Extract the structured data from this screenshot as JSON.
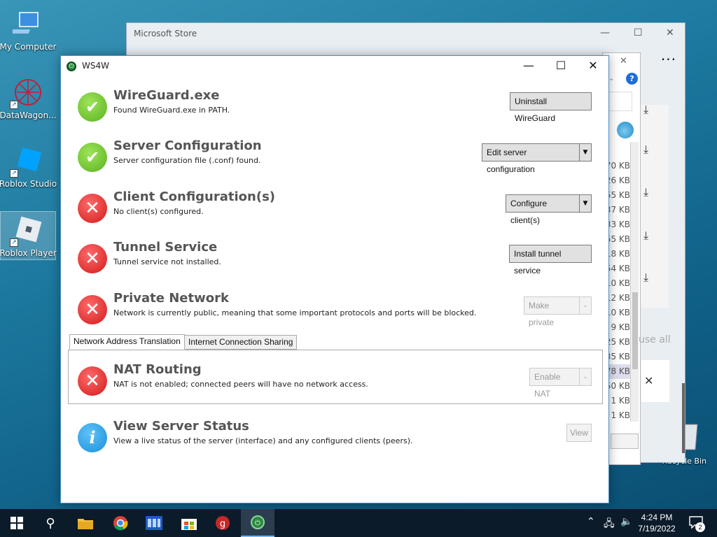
{
  "desktop": {
    "icons": [
      {
        "label": "My Computer"
      },
      {
        "label": "DataWagon..."
      },
      {
        "label": "Roblox Studio"
      },
      {
        "label": "Roblox Player"
      }
    ],
    "recycle_label": "Recycle Bin"
  },
  "store_window": {
    "title": "Microsoft Store",
    "sizes": [
      "70 KB",
      "26 KB",
      "55 KB",
      "37 KB",
      "33 KB",
      "55 KB",
      "18 KB",
      "54 KB",
      "10 KB",
      "12 KB",
      "10 KB",
      "9 KB",
      "25 KB",
      "35 KB",
      "78 KB",
      "50 KB",
      "1 KB",
      "1 KB"
    ],
    "pause_all_partial": "use all"
  },
  "app": {
    "title": "WS4W",
    "rows": {
      "wireguard": {
        "title": "WireGuard.exe",
        "desc": "Found WireGuard.exe in PATH.",
        "button": "Uninstall WireGuard",
        "status": "ok"
      },
      "server_config": {
        "title": "Server Configuration",
        "desc": "Server configuration file (.conf) found.",
        "button": "Edit server configuration",
        "status": "ok"
      },
      "client_config": {
        "title": "Client Configuration(s)",
        "desc": "No client(s) configured.",
        "button": "Configure client(s)",
        "status": "error"
      },
      "tunnel": {
        "title": "Tunnel Service",
        "desc": "Tunnel service not installed.",
        "button": "Install tunnel service",
        "status": "error"
      },
      "private_net": {
        "title": "Private Network",
        "desc": "Network is currently public, meaning that some important protocols and ports will be blocked.",
        "button": "Make private",
        "status": "error"
      },
      "nat": {
        "title": "NAT Routing",
        "desc": "NAT is not enabled; connected peers will have no network access.",
        "button": "Enable NAT",
        "status": "error"
      },
      "server_status": {
        "title": "View Server Status",
        "desc": "View a live status of the server (interface) and any configured clients (peers).",
        "button": "View",
        "status": "info"
      }
    },
    "tabs": [
      "Network Address Translation",
      "Internet Connection Sharing"
    ]
  },
  "taskbar": {
    "time": "4:24 PM",
    "date": "7/19/2022",
    "notification_count": "2"
  }
}
